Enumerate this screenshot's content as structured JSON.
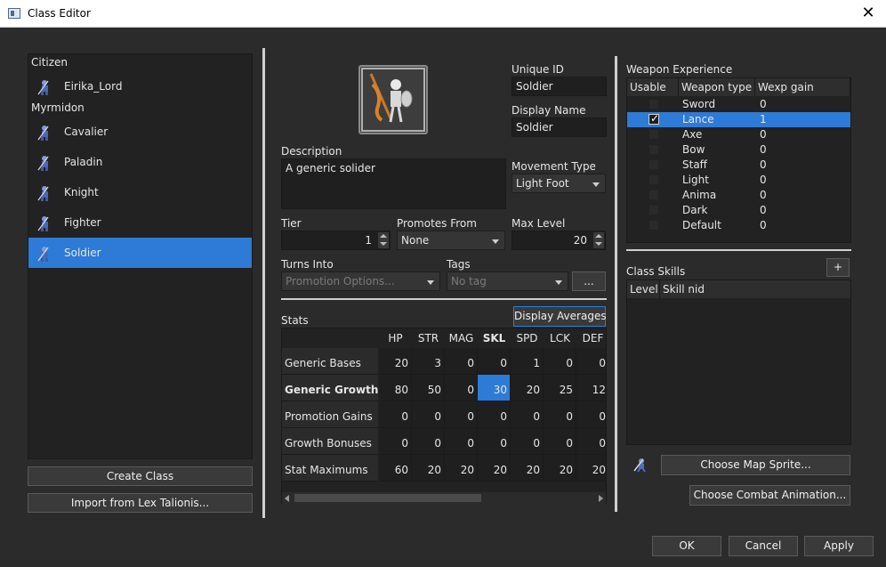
{
  "window": {
    "title": "Class Editor",
    "close_glyph": "✕"
  },
  "class_list": {
    "groups": [
      {
        "name": "Citizen",
        "items": [
          {
            "name": "Eirika_Lord",
            "icon": "lord-sprite-icon"
          }
        ]
      },
      {
        "name": "Myrmidon",
        "items": [
          {
            "name": "Cavalier",
            "icon": "cavalier-sprite-icon"
          },
          {
            "name": "Paladin",
            "icon": "paladin-sprite-icon"
          },
          {
            "name": "Knight",
            "icon": "knight-sprite-icon"
          },
          {
            "name": "Fighter",
            "icon": "fighter-sprite-icon"
          },
          {
            "name": "Soldier",
            "icon": "soldier-sprite-icon",
            "selected": true
          }
        ]
      }
    ],
    "create_button": "Create Class",
    "import_button": "Import from Lex Talionis..."
  },
  "details": {
    "unique_id_label": "Unique ID",
    "unique_id": "Soldier",
    "display_name_label": "Display Name",
    "display_name": "Soldier",
    "description_label": "Description",
    "description": "A generic solider",
    "movement_type_label": "Movement Type",
    "movement_type": "Light Foot",
    "tier_label": "Tier",
    "tier": "1",
    "promotes_from_label": "Promotes From",
    "promotes_from": "None",
    "max_level_label": "Max Level",
    "max_level": "20",
    "turns_into_label": "Turns Into",
    "turns_into_placeholder": "Promotion Options...",
    "tags_label": "Tags",
    "tags_placeholder": "No tag",
    "tags_more_button": "..."
  },
  "stats": {
    "label": "Stats",
    "display_averages_button": "Display Averages",
    "columns": [
      "HP",
      "STR",
      "MAG",
      "SKL",
      "SPD",
      "LCK",
      "DEF"
    ],
    "bold_column": "SKL",
    "rows": [
      {
        "name": "Generic Bases",
        "values": [
          "20",
          "3",
          "0",
          "0",
          "1",
          "0",
          "0"
        ]
      },
      {
        "name": "Generic Growths",
        "bold": true,
        "values": [
          "80",
          "50",
          "0",
          "30",
          "20",
          "25",
          "12"
        ]
      },
      {
        "name": "Promotion Gains",
        "values": [
          "0",
          "0",
          "0",
          "0",
          "0",
          "0",
          "0"
        ]
      },
      {
        "name": "Growth Bonuses",
        "values": [
          "0",
          "0",
          "0",
          "0",
          "0",
          "0",
          "0"
        ]
      },
      {
        "name": "Stat Maximums",
        "values": [
          "60",
          "20",
          "20",
          "20",
          "20",
          "20",
          "20"
        ]
      }
    ],
    "selected_cell": {
      "row": 1,
      "col": 3
    }
  },
  "weapon_experience": {
    "label": "Weapon Experience",
    "headers": [
      "Usable",
      "Weapon type",
      "Wexp gain"
    ],
    "rows": [
      {
        "type": "Sword",
        "gain": "0",
        "usable": false
      },
      {
        "type": "Lance",
        "gain": "1",
        "usable": true,
        "selected": true
      },
      {
        "type": "Axe",
        "gain": "0",
        "usable": false
      },
      {
        "type": "Bow",
        "gain": "0",
        "usable": false
      },
      {
        "type": "Staff",
        "gain": "0",
        "usable": false
      },
      {
        "type": "Light",
        "gain": "0",
        "usable": false
      },
      {
        "type": "Anima",
        "gain": "0",
        "usable": false
      },
      {
        "type": "Dark",
        "gain": "0",
        "usable": false
      },
      {
        "type": "Default",
        "gain": "0",
        "usable": false
      }
    ]
  },
  "class_skills": {
    "label": "Class Skills",
    "add_button": "+",
    "headers": [
      "Level",
      "Skill nid"
    ]
  },
  "sprites": {
    "choose_map_sprite": "Choose Map Sprite...",
    "choose_combat_animation": "Choose Combat Animation..."
  },
  "footer": {
    "ok": "OK",
    "cancel": "Cancel",
    "apply": "Apply"
  },
  "colors": {
    "background": "#2b2b2b",
    "selection": "#2d7bd6",
    "field": "#1f1f1f"
  }
}
